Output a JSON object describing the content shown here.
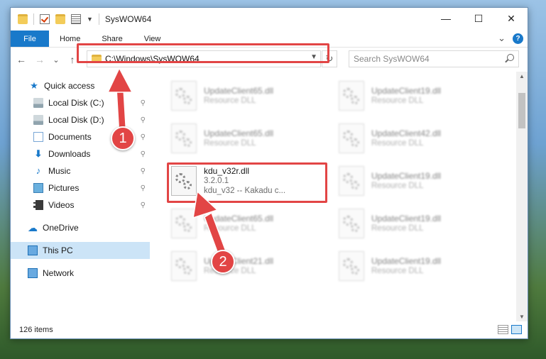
{
  "window": {
    "title": "SysWOW64",
    "controls": {
      "minimize": "—",
      "maximize": "☐",
      "close": "✕"
    }
  },
  "ribbon": {
    "tabs": [
      "File",
      "Home",
      "Share",
      "View"
    ],
    "expand": "⌄",
    "help": "?"
  },
  "navigation": {
    "back": "←",
    "forward": "→",
    "recent": "⌄",
    "up": "↑",
    "address": "C:\\Windows\\SysWOW64",
    "refresh": "↻",
    "search_placeholder": "Search SysWOW64"
  },
  "sidebar": {
    "items": [
      {
        "label": "Quick access",
        "icon": "star-icon",
        "pinned": false
      },
      {
        "label": "Local Disk (C:)",
        "icon": "drive-icon",
        "pinned": true
      },
      {
        "label": "Local Disk (D:)",
        "icon": "drive-icon",
        "pinned": true
      },
      {
        "label": "Documents",
        "icon": "documents-icon",
        "pinned": true
      },
      {
        "label": "Downloads",
        "icon": "download-icon",
        "pinned": true
      },
      {
        "label": "Music",
        "icon": "music-icon",
        "pinned": true
      },
      {
        "label": "Pictures",
        "icon": "pictures-icon",
        "pinned": true
      },
      {
        "label": "Videos",
        "icon": "videos-icon",
        "pinned": true
      },
      {
        "label": "OneDrive",
        "icon": "onedrive-icon"
      },
      {
        "label": "This PC",
        "icon": "pc-icon",
        "selected": true
      },
      {
        "label": "Network",
        "icon": "network-icon"
      }
    ],
    "pin_glyph": "📌"
  },
  "files": {
    "left": [
      {
        "name": "UpdateClient65.dll",
        "sub": "Resource DLL"
      },
      {
        "name": "UpdateClient65.dll",
        "sub": "Resource DLL"
      },
      {
        "name": "kdu_v32r.dll",
        "sub": "3.2.0.1",
        "sub2": "kdu_v32 -- Kakadu c..."
      },
      {
        "name": "UpdateClient65.dll",
        "sub": "Resource DLL"
      },
      {
        "name": "UpdateClient21.dll",
        "sub": "Resource DLL"
      }
    ],
    "right": [
      {
        "name": "UpdateClient19.dll",
        "sub": "Resource DLL"
      },
      {
        "name": "UpdateClient42.dll",
        "sub": "Resource DLL"
      },
      {
        "name": "UpdateClient19.dll",
        "sub": "Resource DLL"
      },
      {
        "name": "UpdateClient19.dll",
        "sub": "Resource DLL"
      },
      {
        "name": "UpdateClient19.dll",
        "sub": "Resource DLL"
      }
    ]
  },
  "status": {
    "items_count": "126 items"
  },
  "callouts": {
    "step1": "1",
    "step2": "2"
  },
  "colors": {
    "accent": "#1979ca",
    "highlight": "#e24545",
    "selected": "#cce4f7"
  }
}
